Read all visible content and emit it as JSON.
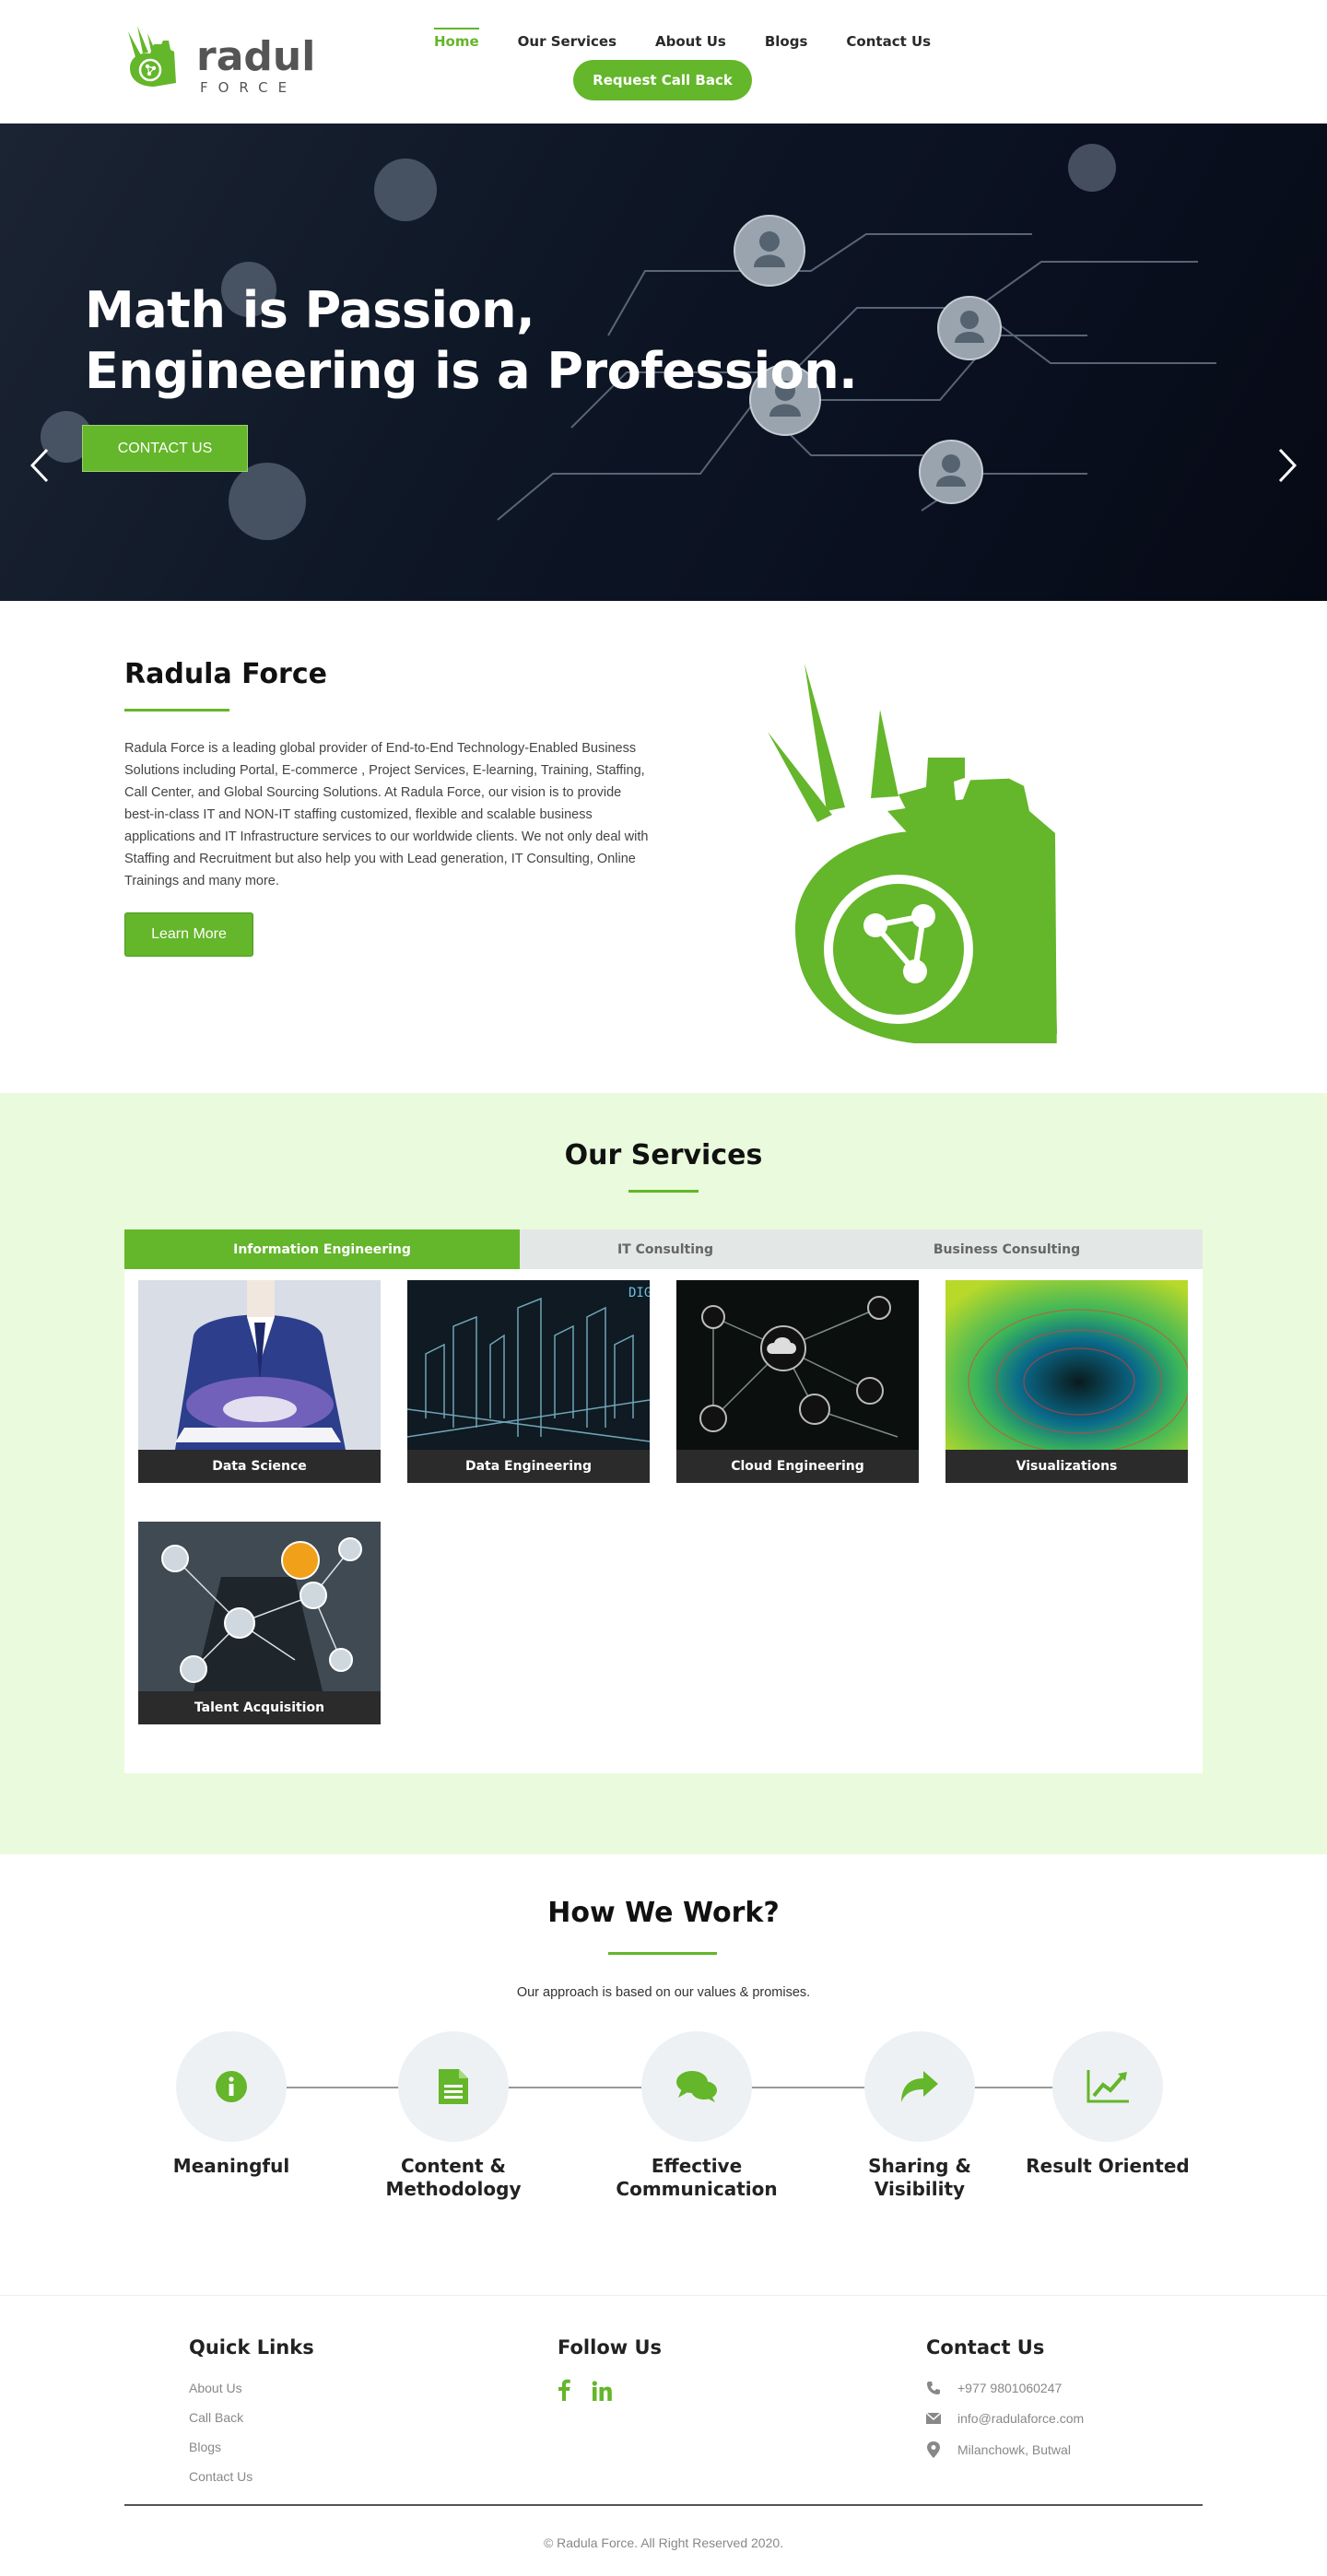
{
  "header": {
    "logo_text": "radula",
    "logo_subtext": "FORCE",
    "nav": [
      "Home",
      "Our Services",
      "About Us",
      "Blogs",
      "Contact Us"
    ],
    "active_nav": "Home",
    "callback_label": "Request Call Back"
  },
  "hero": {
    "title_line1": "Math is Passion,",
    "title_line2": "Engineering is a Profession.",
    "cta_label": "CONTACT US"
  },
  "about": {
    "title": "Radula Force",
    "text": "Radula Force is a leading global provider of End-to-End Technology-Enabled Business Solutions including Portal, E-commerce , Project Services, E-learning, Training, Staffing, Call Center, and Global Sourcing Solutions. At Radula Force, our vision is to provide best-in-class IT and NON-IT staffing customized, flexible and scalable business applications and IT Infrastructure services to our worldwide clients. We not only deal with Staffing and Recruitment but also help you with Lead generation, IT Consulting, Online Trainings and many more.",
    "button_label": "Learn More"
  },
  "services": {
    "title": "Our Services",
    "tabs": [
      "Information Engineering",
      "IT Consulting",
      "Business Consulting"
    ],
    "cards": [
      {
        "label": "Data Science",
        "icon": "tablet-sparkle-image"
      },
      {
        "label": "Data Engineering",
        "icon": "city-hologram-image"
      },
      {
        "label": "Cloud Engineering",
        "icon": "cloud-network-image"
      },
      {
        "label": "Visualizations",
        "icon": "wave-tunnel-image"
      },
      {
        "label": "Talent Acquisition",
        "icon": "people-network-image"
      }
    ]
  },
  "how": {
    "title": "How We Work?",
    "subtitle": "Our approach is based on our values & promises.",
    "steps": [
      {
        "line1": "Meaningful",
        "line2": "",
        "icon": "info-icon"
      },
      {
        "line1": "Content &",
        "line2": "Methodology",
        "icon": "document-icon"
      },
      {
        "line1": "Effective",
        "line2": "Communication",
        "icon": "chat-bubbles-icon"
      },
      {
        "line1": "Sharing &",
        "line2": "Visibility",
        "icon": "share-arrow-icon"
      },
      {
        "line1": "Result Oriented",
        "line2": "",
        "icon": "trend-chart-icon"
      }
    ]
  },
  "footer": {
    "quick_links_title": "Quick Links",
    "quick_links": [
      "About Us",
      "Call Back",
      "Blogs",
      "Contact Us"
    ],
    "follow_title": "Follow Us",
    "social": [
      "facebook-icon",
      "linkedin-icon"
    ],
    "contact_title": "Contact Us",
    "phone": "+977 9801060247",
    "email": "info@radulaforce.com",
    "address": "Milanchowk, Butwal",
    "copyright": "© Radula Force. All Right Reserved 2020."
  },
  "colors": {
    "brand_green": "#64b62a",
    "services_bg": "#e9fbdc",
    "dark": "#2b2b2b"
  }
}
